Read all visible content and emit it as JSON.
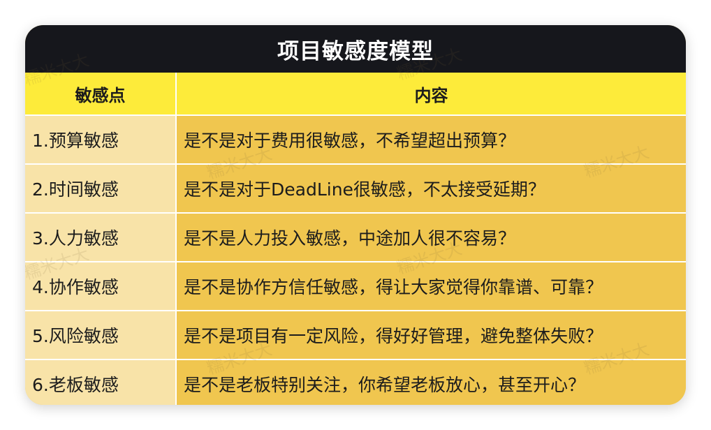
{
  "title": "项目敏感度模型",
  "headers": {
    "col1": "敏感点",
    "col2": "内容"
  },
  "rows": [
    {
      "name": "1.预算敏感",
      "desc": "是不是对于费用很敏感，不希望超出预算？"
    },
    {
      "name": "2.时间敏感",
      "desc": "是不是对于DeadLine很敏感，不太接受延期？"
    },
    {
      "name": "3.人力敏感",
      "desc": "是不是人力投入敏感，中途加人很不容易？"
    },
    {
      "name": "4.协作敏感",
      "desc": "是不是协作方信任敏感，得让大家觉得你靠谱、可靠？"
    },
    {
      "name": "5.风险敏感",
      "desc": "是不是项目有一定风险，得好好管理，避免整体失败？"
    },
    {
      "name": "6.老板敏感",
      "desc": "是不是老板特别关注，你希望老板放心，甚至开心？"
    }
  ],
  "watermark": "糯米大大",
  "colors": {
    "title_bg": "#16171c",
    "header_bg": "#fdeb3a",
    "name_cell_bg": "#f8e3a8",
    "desc_cell_bg": "#f0c64f"
  }
}
